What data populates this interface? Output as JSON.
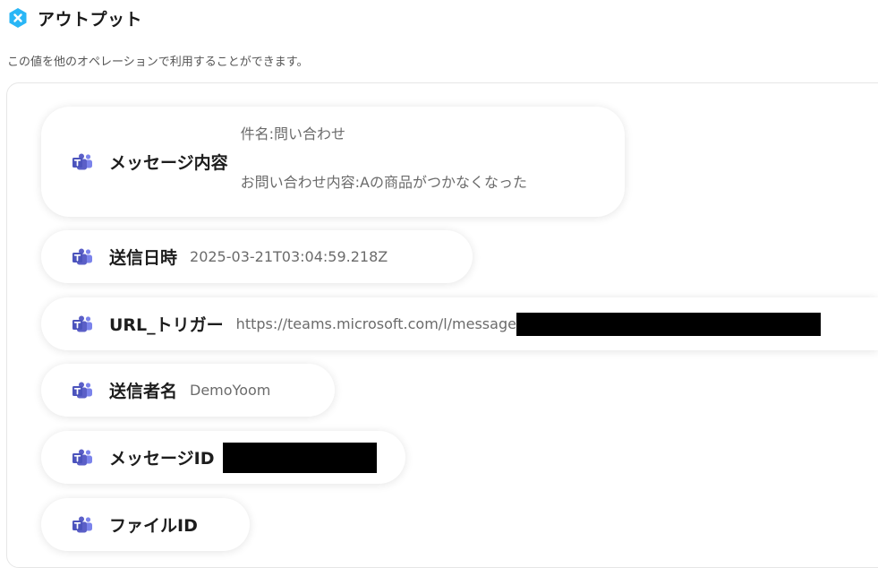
{
  "header": {
    "title": "アウトプット",
    "logo_icon": "yoom-x-icon"
  },
  "description": "この値を他のオペレーションで利用することができます。",
  "colors": {
    "accent": "#29b6f6",
    "teams": "#5b5fc7",
    "teams_light": "#7b83eb"
  },
  "outputs": [
    {
      "label": "メッセージ内容",
      "value_lines": [
        "件名:問い合わせ",
        "お問い合わせ内容:Aの商品がつかなくなった"
      ]
    },
    {
      "label": "送信日時",
      "value": "2025-03-21T03:04:59.218Z"
    },
    {
      "label": "URL_トリガー",
      "value": "https://teams.microsoft.com/l/message",
      "redacted": true
    },
    {
      "label": "送信者名",
      "value": "DemoYoom"
    },
    {
      "label": "メッセージID",
      "value": "",
      "redacted": true
    },
    {
      "label": "ファイルID",
      "value": ""
    }
  ]
}
